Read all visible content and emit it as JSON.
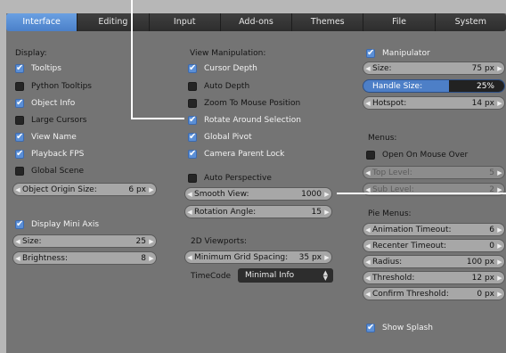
{
  "tabs": [
    "Interface",
    "Editing",
    "Input",
    "Add-ons",
    "Themes",
    "File",
    "System"
  ],
  "display": {
    "header": "Display:",
    "checks": [
      {
        "label": "Tooltips",
        "checked": true
      },
      {
        "label": "Python Tooltips",
        "checked": false
      },
      {
        "label": "Object Info",
        "checked": true
      },
      {
        "label": "Large Cursors",
        "checked": false
      },
      {
        "label": "View Name",
        "checked": true
      },
      {
        "label": "Playback FPS",
        "checked": true
      },
      {
        "label": "Global Scene",
        "checked": false
      }
    ],
    "object_origin_size": {
      "label": "Object Origin Size:",
      "value": "6 px"
    },
    "mini_axis": {
      "label": "Display Mini Axis",
      "checked": true
    },
    "size": {
      "label": "Size:",
      "value": "25"
    },
    "brightness": {
      "label": "Brightness:",
      "value": "8"
    }
  },
  "view": {
    "header": "View Manipulation:",
    "checks": [
      {
        "label": "Cursor Depth",
        "checked": true
      },
      {
        "label": "Auto Depth",
        "checked": false
      },
      {
        "label": "Zoom To Mouse Position",
        "checked": false
      },
      {
        "label": "Rotate Around Selection",
        "checked": true
      },
      {
        "label": "Global Pivot",
        "checked": true
      },
      {
        "label": "Camera Parent Lock",
        "checked": true
      }
    ],
    "auto_perspective": {
      "label": "Auto Perspective",
      "checked": false
    },
    "smooth_view": {
      "label": "Smooth View:",
      "value": "1000"
    },
    "rotation_angle": {
      "label": "Rotation Angle:",
      "value": "15"
    },
    "viewports_header": "2D Viewports:",
    "min_grid": {
      "label": "Minimum Grid Spacing:",
      "value": "35 px"
    },
    "timecode": {
      "label": "TimeCode",
      "value": "Minimal Info"
    }
  },
  "manip": {
    "manipulator": {
      "label": "Manipulator",
      "checked": true
    },
    "size": {
      "label": "Size:",
      "value": "75 px"
    },
    "handle_size": {
      "label": "Handle Size:",
      "value": "25%"
    },
    "hotspot": {
      "label": "Hotspot:",
      "value": "14 px"
    },
    "menus_header": "Menus:",
    "open_on_mouse_over": {
      "label": "Open On Mouse Over",
      "checked": false
    },
    "top_level": {
      "label": "Top Level:",
      "value": "5"
    },
    "sub_level": {
      "label": "Sub Level:",
      "value": "2"
    },
    "pie_header": "Pie Menus:",
    "pie": [
      {
        "label": "Animation Timeout:",
        "value": "6"
      },
      {
        "label": "Recenter Timeout:",
        "value": "0"
      },
      {
        "label": "Radius:",
        "value": "100 px"
      },
      {
        "label": "Threshold:",
        "value": "12 px"
      },
      {
        "label": "Confirm Threshold:",
        "value": "0 px"
      }
    ],
    "show_splash": {
      "label": "Show Splash",
      "checked": true
    }
  }
}
